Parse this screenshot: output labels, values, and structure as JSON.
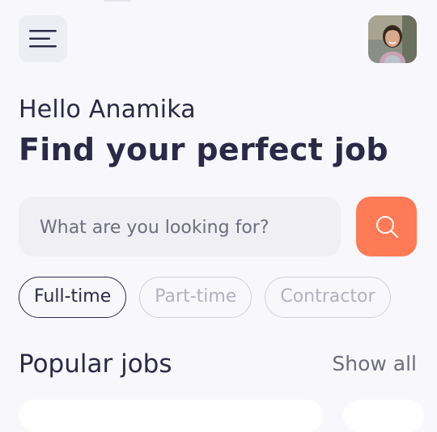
{
  "header": {
    "menu_icon": "hamburger-menu-icon",
    "avatar_icon": "user-avatar"
  },
  "greeting": "Hello Anamika",
  "headline": "Find your perfect job",
  "search": {
    "placeholder": "What are you looking for?",
    "value": "",
    "button_icon": "search-icon",
    "button_color": "#ff7a56"
  },
  "filters": [
    {
      "label": "Full-time",
      "active": true
    },
    {
      "label": "Part-time",
      "active": false
    },
    {
      "label": "Contractor",
      "active": false
    }
  ],
  "popular": {
    "title": "Popular jobs",
    "show_all": "Show all"
  },
  "colors": {
    "background": "#f8f8fc",
    "text": "#2b2946",
    "accent": "#ff7a56",
    "muted": "#6e6d80"
  }
}
